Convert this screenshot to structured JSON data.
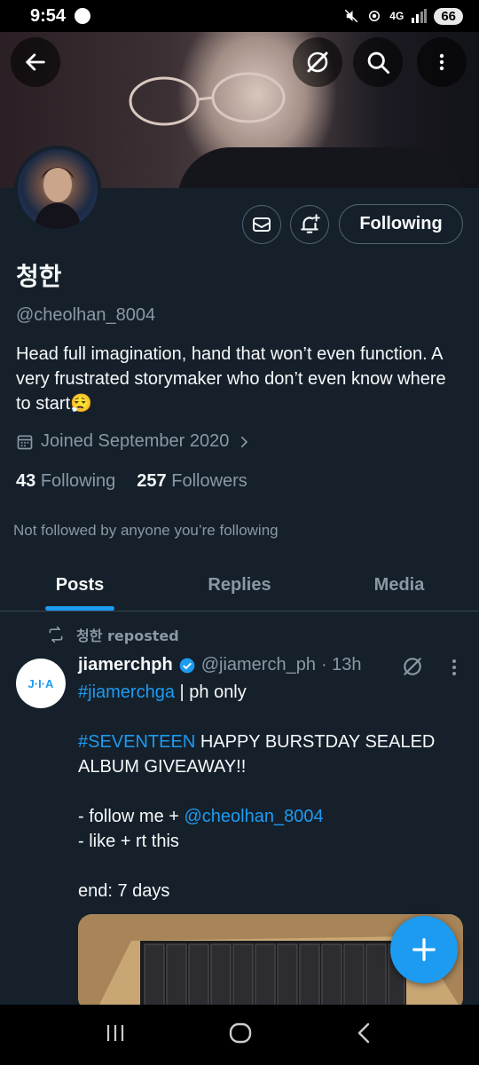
{
  "status_bar": {
    "time": "9:54",
    "network": "4G",
    "battery": "66"
  },
  "profile": {
    "name": "청한",
    "handle": "@cheolhan_8004",
    "bio": "Head full imagination, hand that won’t even function. A very frustrated storymaker who don’t even know where to start😮‍💨",
    "joined": "Joined September 2020",
    "following_count": "43",
    "following_label": "Following",
    "followers_count": "257",
    "followers_label": "Followers",
    "not_followed_text": "Not followed by anyone you’re following",
    "follow_button_label": "Following"
  },
  "tabs": [
    {
      "label": "Posts",
      "active": true
    },
    {
      "label": "Replies",
      "active": false
    },
    {
      "label": "Media",
      "active": false
    }
  ],
  "post": {
    "repost_label": "청한 reposted",
    "avatar_text": "J·I·A",
    "author": "jiamerchph",
    "author_handle": "@jiamerch_ph",
    "time": "· 13h",
    "hashtag1": "#jiamerchga",
    "line1_rest": " | ph only",
    "hashtag2": "#SEVENTEEN",
    "line2_rest": " HAPPY BURSTDAY SEALED ALBUM GIVEAWAY!!",
    "line3": "- follow me + ",
    "mention": "@cheolhan_8004",
    "line4": "- like + rt this",
    "line5": "end: 7 days"
  },
  "colors": {
    "background": "#15202b",
    "accent": "#1d9bf0",
    "muted": "#8b98a5",
    "border": "#536471"
  },
  "icons": [
    "back-arrow-icon",
    "grok-icon",
    "search-icon",
    "more-vertical-icon",
    "mail-icon",
    "bell-plus-icon",
    "calendar-icon",
    "chevron-right-icon",
    "repost-icon",
    "verified-badge-icon",
    "compose-plus-icon",
    "recent-apps-icon",
    "home-icon",
    "back-icon"
  ]
}
